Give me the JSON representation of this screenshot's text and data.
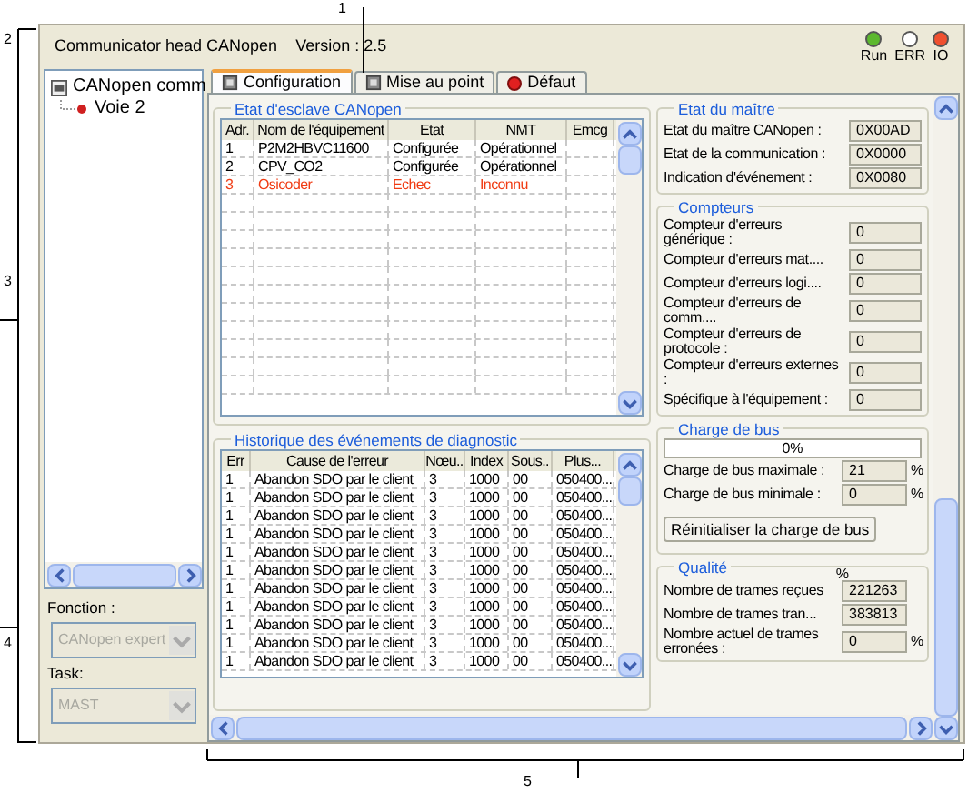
{
  "callouts": [
    "1",
    "2",
    "3",
    "4",
    "5"
  ],
  "header": {
    "title": "Communicator head CANopen",
    "version": "Version : 2.5",
    "leds": [
      {
        "label": "Run",
        "color": "#5cb82e"
      },
      {
        "label": "ERR",
        "color": "#ffffff"
      },
      {
        "label": "IO",
        "color": "#f05030"
      }
    ]
  },
  "tree": {
    "label": "CANopen comm",
    "children": [
      {
        "label": "Voie 2"
      }
    ]
  },
  "fields": [
    {
      "label": "Fonction :",
      "value": "CANopen expert",
      "disabled": true
    },
    {
      "label": "Task:",
      "value": "MAST",
      "disabled": true
    }
  ],
  "tabs": [
    {
      "label": "Configuration",
      "selected": true,
      "kind": "card"
    },
    {
      "label": "Mise au point",
      "selected": false,
      "kind": "card"
    },
    {
      "label": "Défaut",
      "selected": false,
      "kind": "alert"
    }
  ],
  "slaves": {
    "title": "Etat d'esclave CANopen",
    "columns": [
      "Adr.",
      "Nom de l'équipement",
      "Etat",
      "NMT",
      "Emcg"
    ],
    "rows": [
      {
        "cells": [
          "1",
          "P2M2HBVC11600",
          "Configurée",
          "Opérationnel",
          ""
        ],
        "fault": false
      },
      {
        "cells": [
          "2",
          "CPV_CO2",
          "Configurée",
          "Opérationnel",
          ""
        ],
        "fault": false
      },
      {
        "cells": [
          "3",
          "Osicoder",
          "Echec",
          "Inconnu",
          ""
        ],
        "fault": true
      }
    ]
  },
  "history": {
    "title": "Historique des événements de diagnostic",
    "columns": [
      "Err",
      "Cause de l'erreur",
      "Nœu..",
      "Index",
      "Sous..",
      "Plus..."
    ],
    "rows": [
      [
        "1",
        "Abandon SDO par le client",
        "3",
        "1000",
        "00",
        "050400..."
      ],
      [
        "1",
        "Abandon SDO par le client",
        "3",
        "1000",
        "00",
        "050400..."
      ],
      [
        "1",
        "Abandon SDO par le client",
        "3",
        "1000",
        "00",
        "050400..."
      ],
      [
        "1",
        "Abandon SDO par le client",
        "3",
        "1000",
        "00",
        "050400..."
      ],
      [
        "1",
        "Abandon SDO par le client",
        "3",
        "1000",
        "00",
        "050400..."
      ],
      [
        "1",
        "Abandon SDO par le client",
        "3",
        "1000",
        "00",
        "050400..."
      ],
      [
        "1",
        "Abandon SDO par le client",
        "3",
        "1000",
        "00",
        "050400..."
      ],
      [
        "1",
        "Abandon SDO par le client",
        "3",
        "1000",
        "00",
        "050400..."
      ],
      [
        "1",
        "Abandon SDO par le client",
        "3",
        "1000",
        "00",
        "050400..."
      ],
      [
        "1",
        "Abandon SDO par le client",
        "3",
        "1000",
        "00",
        "050400..."
      ],
      [
        "1",
        "Abandon SDO par le client",
        "3",
        "1000",
        "00",
        "050400..."
      ]
    ]
  },
  "master": {
    "title": "Etat du maître",
    "rows": [
      {
        "label": "Etat du maître CANopen :",
        "value": "0X00AD"
      },
      {
        "label": "Etat de la communication :",
        "value": "0X0000"
      },
      {
        "label": "Indication d'événement :",
        "value": "0X0080"
      }
    ]
  },
  "counters": {
    "title": "Compteurs",
    "rows": [
      {
        "label": "Compteur d'erreurs générique :",
        "value": "0"
      },
      {
        "label": "Compteur d'erreurs mat....",
        "value": "0"
      },
      {
        "label": "Compteur d'erreurs logi....",
        "value": "0"
      },
      {
        "label": "Compteur d'erreurs de comm....",
        "value": "0"
      },
      {
        "label": "Compteur d'erreurs de protocole :",
        "value": "0"
      },
      {
        "label": "Compteur d'erreurs externes :",
        "value": "0"
      },
      {
        "label": "Spécifique à l'équipement :",
        "value": "0"
      }
    ]
  },
  "bus_load": {
    "title": "Charge de bus",
    "level": 0,
    "reading": "0%",
    "rows": [
      {
        "label": "Charge de bus maximale :",
        "value": "21",
        "unit": "%"
      },
      {
        "label": "Charge de bus minimale :",
        "value": "0",
        "unit": "%"
      }
    ],
    "button": "Réinitialiser la charge de bus"
  },
  "quality": {
    "title": "Qualité",
    "unit": "%",
    "rows": [
      {
        "label": "Nombre de trames reçues",
        "value": "221263",
        "unit": ""
      },
      {
        "label": "Nombre de trames tran...",
        "value": "383813",
        "unit": ""
      },
      {
        "label": "Nombre actuel de trames erronées :",
        "value": "0",
        "unit": "%"
      }
    ]
  }
}
